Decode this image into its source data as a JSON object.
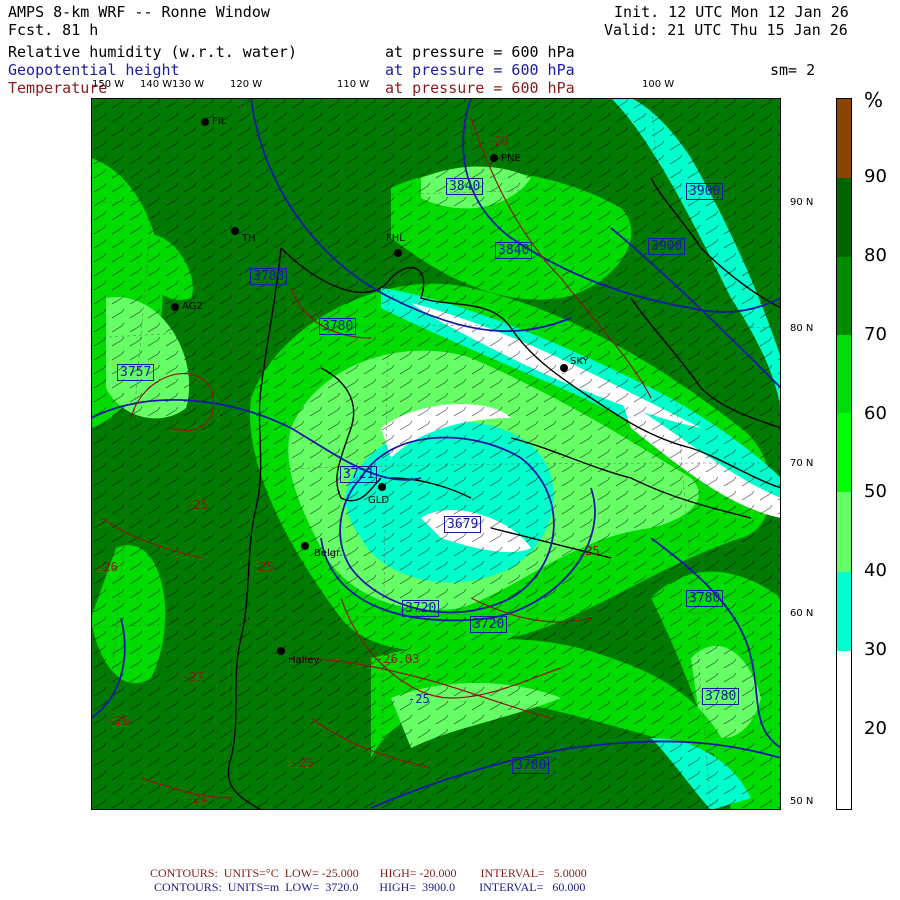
{
  "header": {
    "title": "AMPS 8-km WRF -- Ronne Window",
    "forecast": "Fcst.   81 h",
    "init": "Init. 12 UTC Mon 12 Jan 26",
    "valid": "Valid: 21 UTC Thu 15 Jan 26",
    "smoothing": "sm= 2"
  },
  "fields": [
    {
      "name": "Relative humidity (w.r.t. water)",
      "level": "at pressure =  600 hPa"
    },
    {
      "name": "Geopotential height",
      "level": "at pressure =  600 hPa"
    },
    {
      "name": "Temperature",
      "level": "at pressure =  600 hPa"
    }
  ],
  "longitude_labels": [
    "150 W",
    "140 W",
    "130 W",
    "120 W",
    "110 W",
    "100 W"
  ],
  "latitude_labels": [
    "90 N",
    "80 N",
    "70 N",
    "60 N",
    "50 N"
  ],
  "colorbar": {
    "unit": "%",
    "ticks": [
      "90",
      "80",
      "70",
      "60",
      "50",
      "40",
      "30",
      "20"
    ],
    "bands": [
      {
        "range": "90-100",
        "color": "#8b4500"
      },
      {
        "range": "80-90",
        "color": "#006400"
      },
      {
        "range": "70-80",
        "color": "#008c00"
      },
      {
        "range": "60-70",
        "color": "#00dc00"
      },
      {
        "range": "50-60",
        "color": "#00ff00"
      },
      {
        "range": "40-50",
        "color": "#66ff66"
      },
      {
        "range": "30-40",
        "color": "#00ffcc"
      },
      {
        "range": "20-30",
        "color": "#ffffff"
      },
      {
        "range": "10-20",
        "color": "#ffffff"
      }
    ]
  },
  "stations": [
    "FIL",
    "PNE",
    "FHL",
    "TH",
    "AG2",
    "SKY",
    "GLD",
    "Belgr.",
    "Halley"
  ],
  "height_labels": [
    "3840",
    "3900",
    "3840",
    "3900",
    "3780",
    "3780",
    "3757",
    "3721",
    "3679",
    "3720",
    "3720",
    "3780",
    "3780",
    "3780"
  ],
  "temperature_labels": [
    "-25",
    "-20",
    "-26",
    "-25",
    "-26.03",
    "-27",
    "-25",
    "-26",
    "-25",
    "-25",
    "-24"
  ],
  "footer": {
    "temperature_contours": "CONTOURS:  UNITS=°C  LOW= -25.000       HIGH= -20.000        INTERVAL=   5.0000",
    "height_contours": "CONTOURS:  UNITS=m  LOW=  3720.0       HIGH=  3900.0        INTERVAL=   60.000"
  },
  "colors": {
    "height_contour": "#1a1aa6",
    "temperature_contour": "#8b1a1a",
    "coastline": "#000000"
  }
}
